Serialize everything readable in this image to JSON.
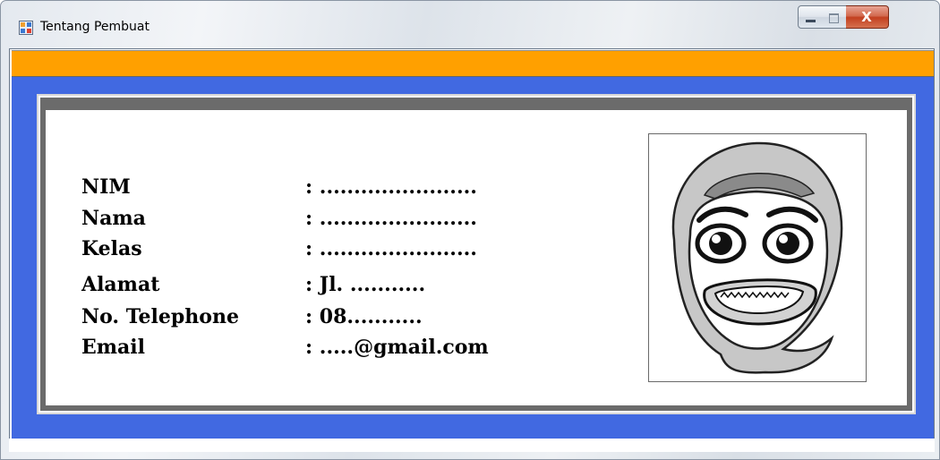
{
  "window": {
    "title": "Tentang Pembuat",
    "close_glyph": "X"
  },
  "colors": {
    "header_bar": "#ffa000",
    "panel": "#4169e1",
    "card_frame": "#6b6b6b"
  },
  "info": {
    "rows": [
      {
        "label": "NIM",
        "value": ": ......................."
      },
      {
        "label": "Nama",
        "value": ": ......................."
      },
      {
        "label": "Kelas",
        "value": ": ......................."
      },
      {
        "label": "Alamat",
        "value": ": Jl. ..........."
      },
      {
        "label": "No. Telephone",
        "value": ": 08..........."
      },
      {
        "label": "Email",
        "value": ": .....@gmail.com"
      }
    ]
  },
  "photo": {
    "icon": "hijab-cartoon-face-icon"
  }
}
